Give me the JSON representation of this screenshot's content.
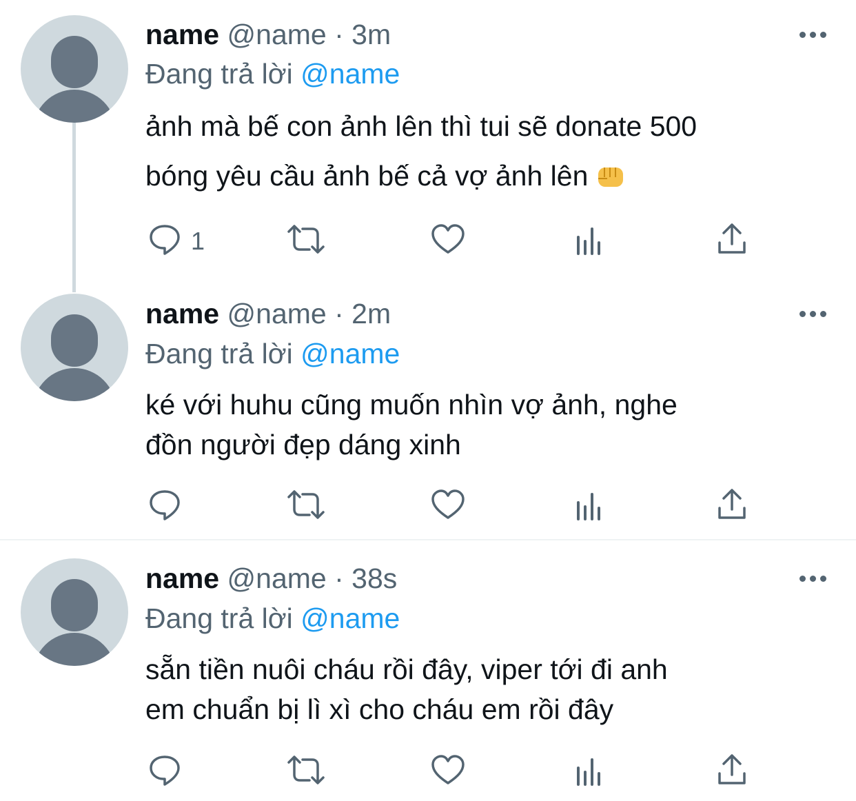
{
  "tweets": [
    {
      "name": "name",
      "handle": "@name",
      "separator": "·",
      "time": "3m",
      "replying_prefix": "Đang trả lời",
      "replying_to": "@name",
      "body_line1": "ảnh mà bế con ảnh lên thì tui sẽ donate 500",
      "body_line2": "bóng yêu cầu ảnh bế cả vợ ảnh lên",
      "body_emoji": "oncoming-fist-emoji",
      "reply_count": "1"
    },
    {
      "name": "name",
      "handle": "@name",
      "separator": "·",
      "time": "2m",
      "replying_prefix": "Đang trả lời",
      "replying_to": "@name",
      "body_line1": "ké với huhu cũng muốn nhìn vợ ảnh, nghe",
      "body_line2": "đồn người đẹp dáng xinh",
      "reply_count": ""
    },
    {
      "name": "name",
      "handle": "@name",
      "separator": "·",
      "time": "38s",
      "replying_prefix": "Đang trả lời",
      "replying_to": "@name",
      "body_line1": "sẵn tiền nuôi cháu rồi đây, viper tới đi anh",
      "body_line2": "em chuẩn bị lì xì cho cháu em rồi đây",
      "reply_count": ""
    }
  ],
  "icons": {
    "reply": "reply-icon",
    "retweet": "retweet-icon",
    "like": "heart-icon",
    "analytics": "analytics-icon",
    "share": "share-icon",
    "more": "more-icon"
  },
  "colors": {
    "text": "#0f1419",
    "secondary": "#536471",
    "mention": "#1d9bf0",
    "avatar_bg": "#cfd9de",
    "avatar_fg": "#687684"
  }
}
